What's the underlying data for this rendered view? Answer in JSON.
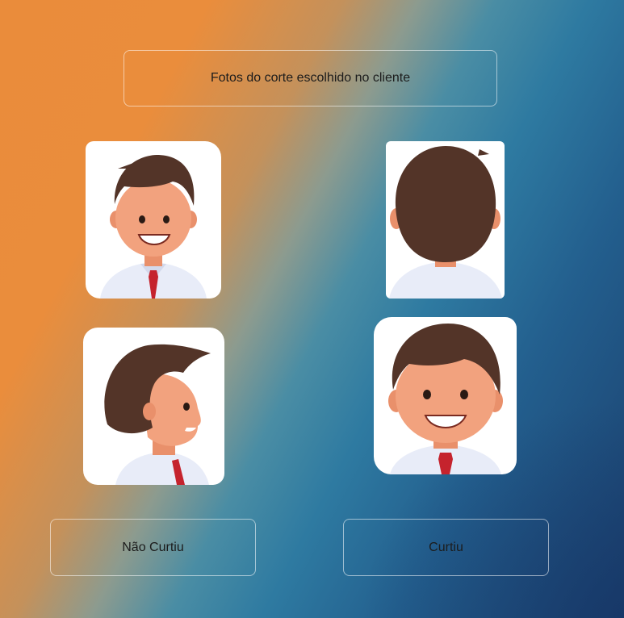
{
  "header": {
    "title": "Fotos do corte escolhido no cliente"
  },
  "photos": [
    {
      "view": "front"
    },
    {
      "view": "back"
    },
    {
      "view": "side"
    },
    {
      "view": "front-closeup"
    }
  ],
  "actions": {
    "dislike_label": "Não Curtiu",
    "like_label": "Curtiu"
  },
  "colors": {
    "hair": "#533428",
    "skin": "#f2a27e",
    "shirt": "#e8ecf8",
    "tie": "#c5232d",
    "bg_orange": "#ea8c3b",
    "bg_blue": "#1b3f6d"
  }
}
